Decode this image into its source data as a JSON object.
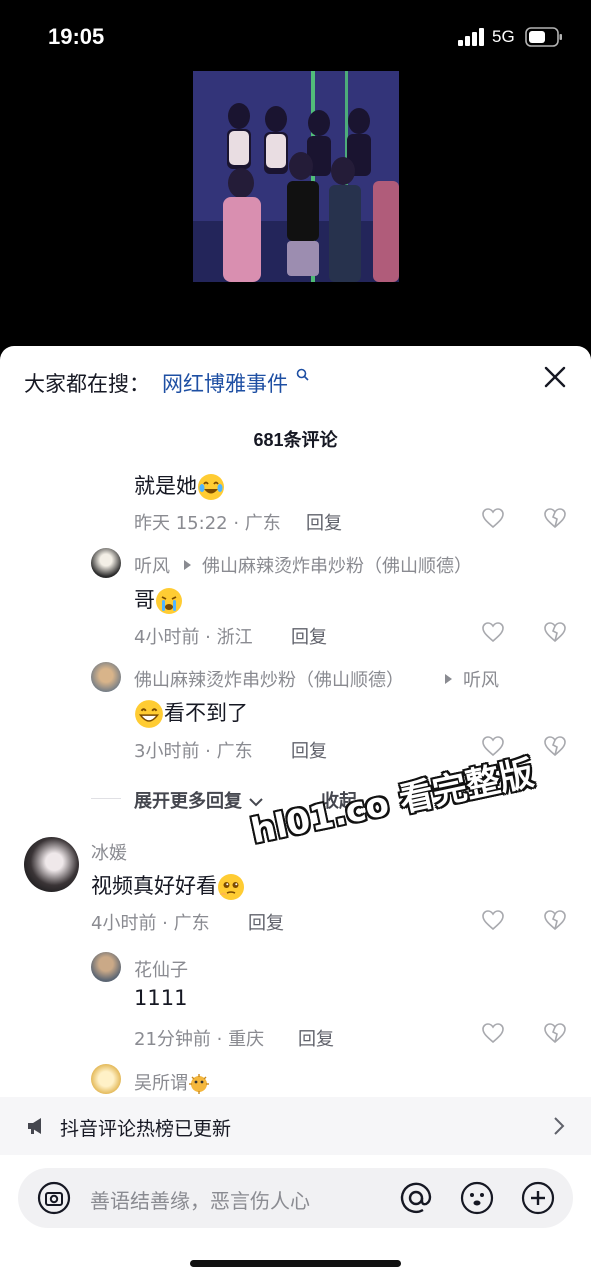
{
  "status_bar": {
    "time": "19:05",
    "network": "5G"
  },
  "search_suggest": {
    "label": "大家都在搜：",
    "keyword": "网红博雅事件"
  },
  "comments_count": "681条评论",
  "comments": [
    {
      "text": "就是她",
      "emoji": "laughing-crying-emoji",
      "time": "昨天 15:22 · 广东",
      "reply": "回复"
    },
    {
      "user": "听风",
      "target": "佛山麻辣烫炸串炒粉（佛山顺德）",
      "text": "哥",
      "emoji": "crying-emoji",
      "time": "4小时前 · 浙江",
      "reply": "回复"
    },
    {
      "user": "佛山麻辣烫炸串炒粉（佛山顺德）",
      "target": "听风",
      "text": "看不到了",
      "emoji": "grinning-emoji",
      "time": "3小时前 · 广东",
      "reply": "回复"
    },
    {
      "user": "冰媛",
      "text": "视频真好好看",
      "emoji": "pleading-emoji",
      "time": "4小时前 · 广东",
      "reply": "回复"
    },
    {
      "user": "花仙子",
      "text": "1111",
      "time": "21分钟前 · 重庆",
      "reply": "回复"
    },
    {
      "user": "吴所谓",
      "emoji": "pufferfish-emoji"
    }
  ],
  "expand_more": "展开更多回复",
  "collapse": "收起",
  "watermark": "hl01.co 看完整版",
  "notice": {
    "text": "抖音评论热榜已更新"
  },
  "input": {
    "placeholder": "善语结善缘，恶言伤人心"
  },
  "colors": {
    "keyword": "#1e4fa3",
    "meta": "#8a8b91",
    "sheet_bg": "#ffffff",
    "notice_bg": "#f6f6f8"
  }
}
